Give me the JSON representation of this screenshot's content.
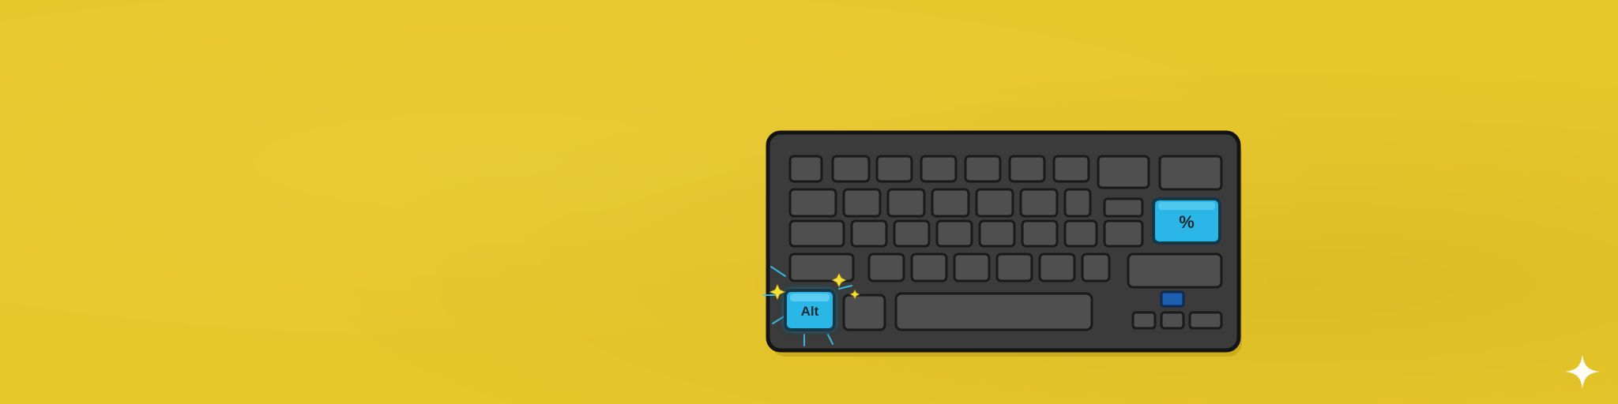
{
  "keyboard": {
    "alt_key_label": "Alt",
    "percent_key_label": "%"
  },
  "colors": {
    "background": "#e8c72a",
    "keyboard_body": "#3b3b3b",
    "key_gray": "#4f4f4f",
    "highlight_key": "#2ab6e6",
    "arrow_key_blue": "#1c5fb0"
  },
  "icons": [
    "sparkle-icon"
  ]
}
